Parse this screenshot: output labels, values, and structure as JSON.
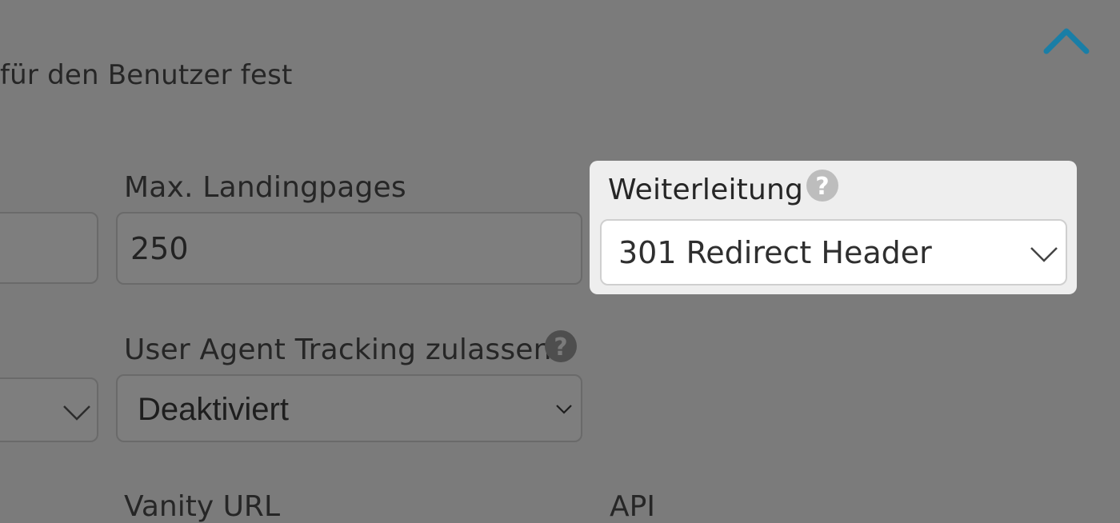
{
  "header": {
    "intro_text": "für den Benutzer fest",
    "collapse_icon": "chevron-up-icon",
    "accent_color": "#1a7ea6"
  },
  "fields": {
    "left_partial_value": "",
    "max_landingpages": {
      "label": "Max. Landingpages",
      "value": "250"
    },
    "weiterleitung": {
      "label": "Weiterleitung",
      "value": "301 Redirect Header",
      "help_icon": "question-circle-icon"
    },
    "user_agent_tracking": {
      "label": "User Agent Tracking zulassen",
      "value": "Deaktiviert",
      "help_icon": "question-circle-icon"
    },
    "vanity_url": {
      "label": "Vanity URL"
    },
    "api": {
      "label": "API"
    }
  }
}
